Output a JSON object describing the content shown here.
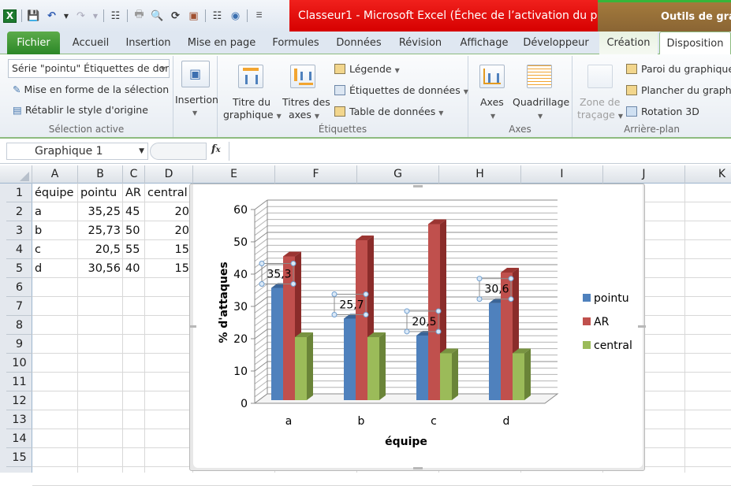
{
  "app": {
    "window_title": "Classeur1  -  Microsoft Excel (Échec de l’activation du p...",
    "contextual_tools_title": "Outils de grap"
  },
  "qat": {
    "icons": [
      "excel-logo-icon",
      "save-icon",
      "undo-icon",
      "redo-icon",
      "hierarchy-icon",
      "print-preview-icon",
      "zoom-page-icon",
      "refresh-icon",
      "contact-icon",
      "hierarchy2-icon",
      "watch-icon",
      "customize-qat-icon"
    ]
  },
  "tabs": [
    {
      "label": "Fichier"
    },
    {
      "label": "Accueil"
    },
    {
      "label": "Insertion"
    },
    {
      "label": "Mise en page"
    },
    {
      "label": "Formules"
    },
    {
      "label": "Données"
    },
    {
      "label": "Révision"
    },
    {
      "label": "Affichage"
    },
    {
      "label": "Développeur"
    },
    {
      "label": "Création"
    },
    {
      "label": "Disposition"
    }
  ],
  "ribbon": {
    "selection": {
      "combo_value": "Série \"pointu\" Étiquettes de dor",
      "format_selection": "Mise en forme de la sélection",
      "reset_style": "Rétablir le style d'origine",
      "group_label": "Sélection active"
    },
    "insert": {
      "label": "Insertion"
    },
    "labels": {
      "chart_title_1": "Titre du",
      "chart_title_2": "graphique",
      "axis_titles_1": "Titres des",
      "axis_titles_2": "axes",
      "legend": "Légende",
      "data_labels": "Étiquettes de données",
      "data_table": "Table de données",
      "group_label": "Étiquettes"
    },
    "axes": {
      "axes": "Axes",
      "gridlines": "Quadrillage",
      "group_label": "Axes"
    },
    "background": {
      "plot_area_1": "Zone de",
      "plot_area_2": "traçage",
      "chart_wall": "Paroi du graphique",
      "chart_floor": "Plancher du graphique",
      "rotation": "Rotation 3D",
      "group_label": "Arrière-plan"
    }
  },
  "formula_bar": {
    "name_box": "Graphique 1",
    "fx_label": "fx",
    "formula": ""
  },
  "sheet": {
    "columns": [
      "A",
      "B",
      "C",
      "D",
      "E",
      "F",
      "G",
      "H",
      "I",
      "J",
      "K"
    ],
    "rows": [
      "1",
      "2",
      "3",
      "4",
      "5",
      "6",
      "7",
      "8",
      "9",
      "10",
      "11",
      "12",
      "13",
      "14",
      "15"
    ],
    "cells": [
      [
        "équipe",
        "pointu",
        "AR",
        "central"
      ],
      [
        "a",
        "35,25",
        "45",
        "20"
      ],
      [
        "b",
        "25,73",
        "50",
        "20"
      ],
      [
        "c",
        "20,5",
        "55",
        "15"
      ],
      [
        "d",
        "30,56",
        "40",
        "15"
      ]
    ]
  },
  "colors": {
    "pointu": "#4f81bd",
    "AR": "#c0504d",
    "central": "#9bbb59",
    "title_bar_red": "#e01010",
    "file_tab_green": "#3e9a35"
  },
  "chart_data": {
    "type": "bar",
    "variant": "3d-clustered-column",
    "title": "",
    "xlabel": "équipe",
    "ylabel": "% d'attaques",
    "categories": [
      "a",
      "b",
      "c",
      "d"
    ],
    "series": [
      {
        "name": "pointu",
        "values": [
          35.25,
          25.73,
          20.5,
          30.56
        ]
      },
      {
        "name": "AR",
        "values": [
          45,
          50,
          55,
          40
        ]
      },
      {
        "name": "central",
        "values": [
          20,
          20,
          15,
          15
        ]
      }
    ],
    "data_labels": {
      "series": "pointu",
      "labels": [
        "35,3",
        "25,7",
        "20,5",
        "30,6"
      ],
      "selected": true
    },
    "ylim": [
      0,
      60
    ],
    "yticks": [
      "0",
      "10",
      "20",
      "30",
      "40",
      "50",
      "60"
    ],
    "minor_step": 2,
    "grid": true,
    "legend": "right"
  }
}
